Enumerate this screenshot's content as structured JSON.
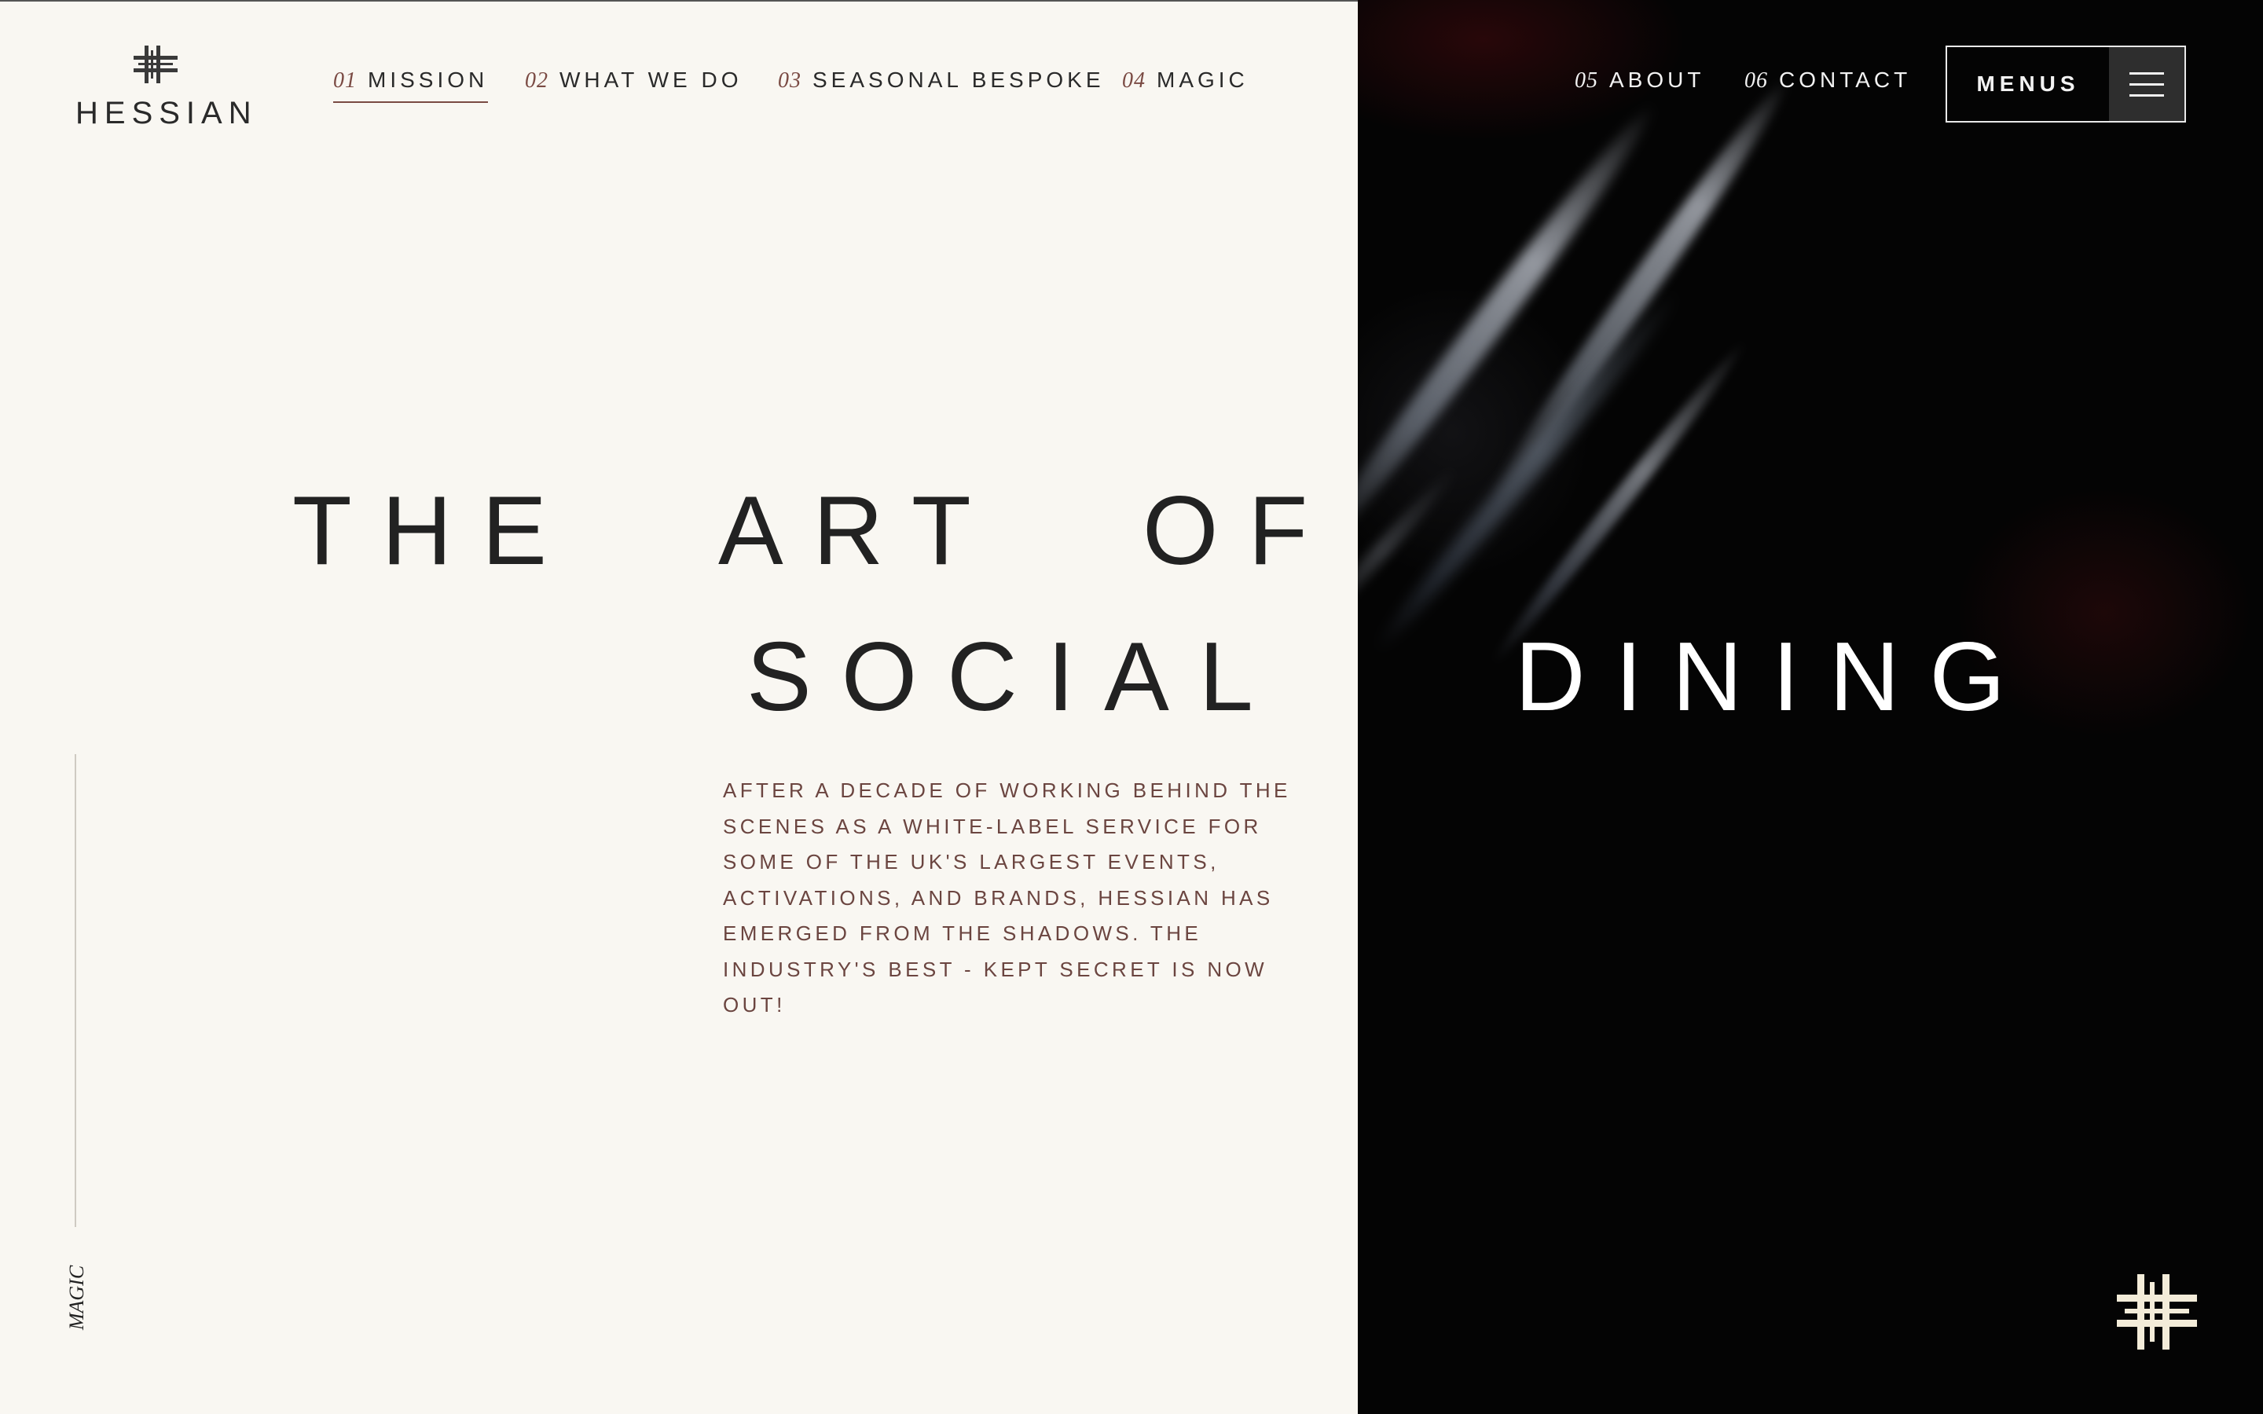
{
  "brand": {
    "name": "HESSIAN",
    "logo_icon": "hash-weave-icon"
  },
  "nav": {
    "items": [
      {
        "num": "01",
        "label": "MISSION",
        "active": true
      },
      {
        "num": "02",
        "label": "WHAT WE DO"
      },
      {
        "num": "03",
        "label": "SEASONAL BESPOKE"
      },
      {
        "num": "04",
        "label": "MAGIC"
      },
      {
        "num": "05",
        "label": "ABOUT"
      },
      {
        "num": "06",
        "label": "CONTACT"
      }
    ],
    "menus_label": "MENUS",
    "menus_icon": "hamburger-icon"
  },
  "hero": {
    "words": [
      "THE",
      "ART",
      "OF",
      "SOCIAL",
      "DINING"
    ],
    "intro": "After a decade of working behind the scenes as a white-label service for some of the UK's largest events, activations, and brands, Hessian has emerged from the shadows. The industry's best - kept secret is now out!"
  },
  "side": {
    "label": "MAGIC"
  },
  "colors": {
    "background": "#f9f7f2",
    "dark_panel": "#040404",
    "accent": "#7a4a43",
    "text": "#222222"
  }
}
